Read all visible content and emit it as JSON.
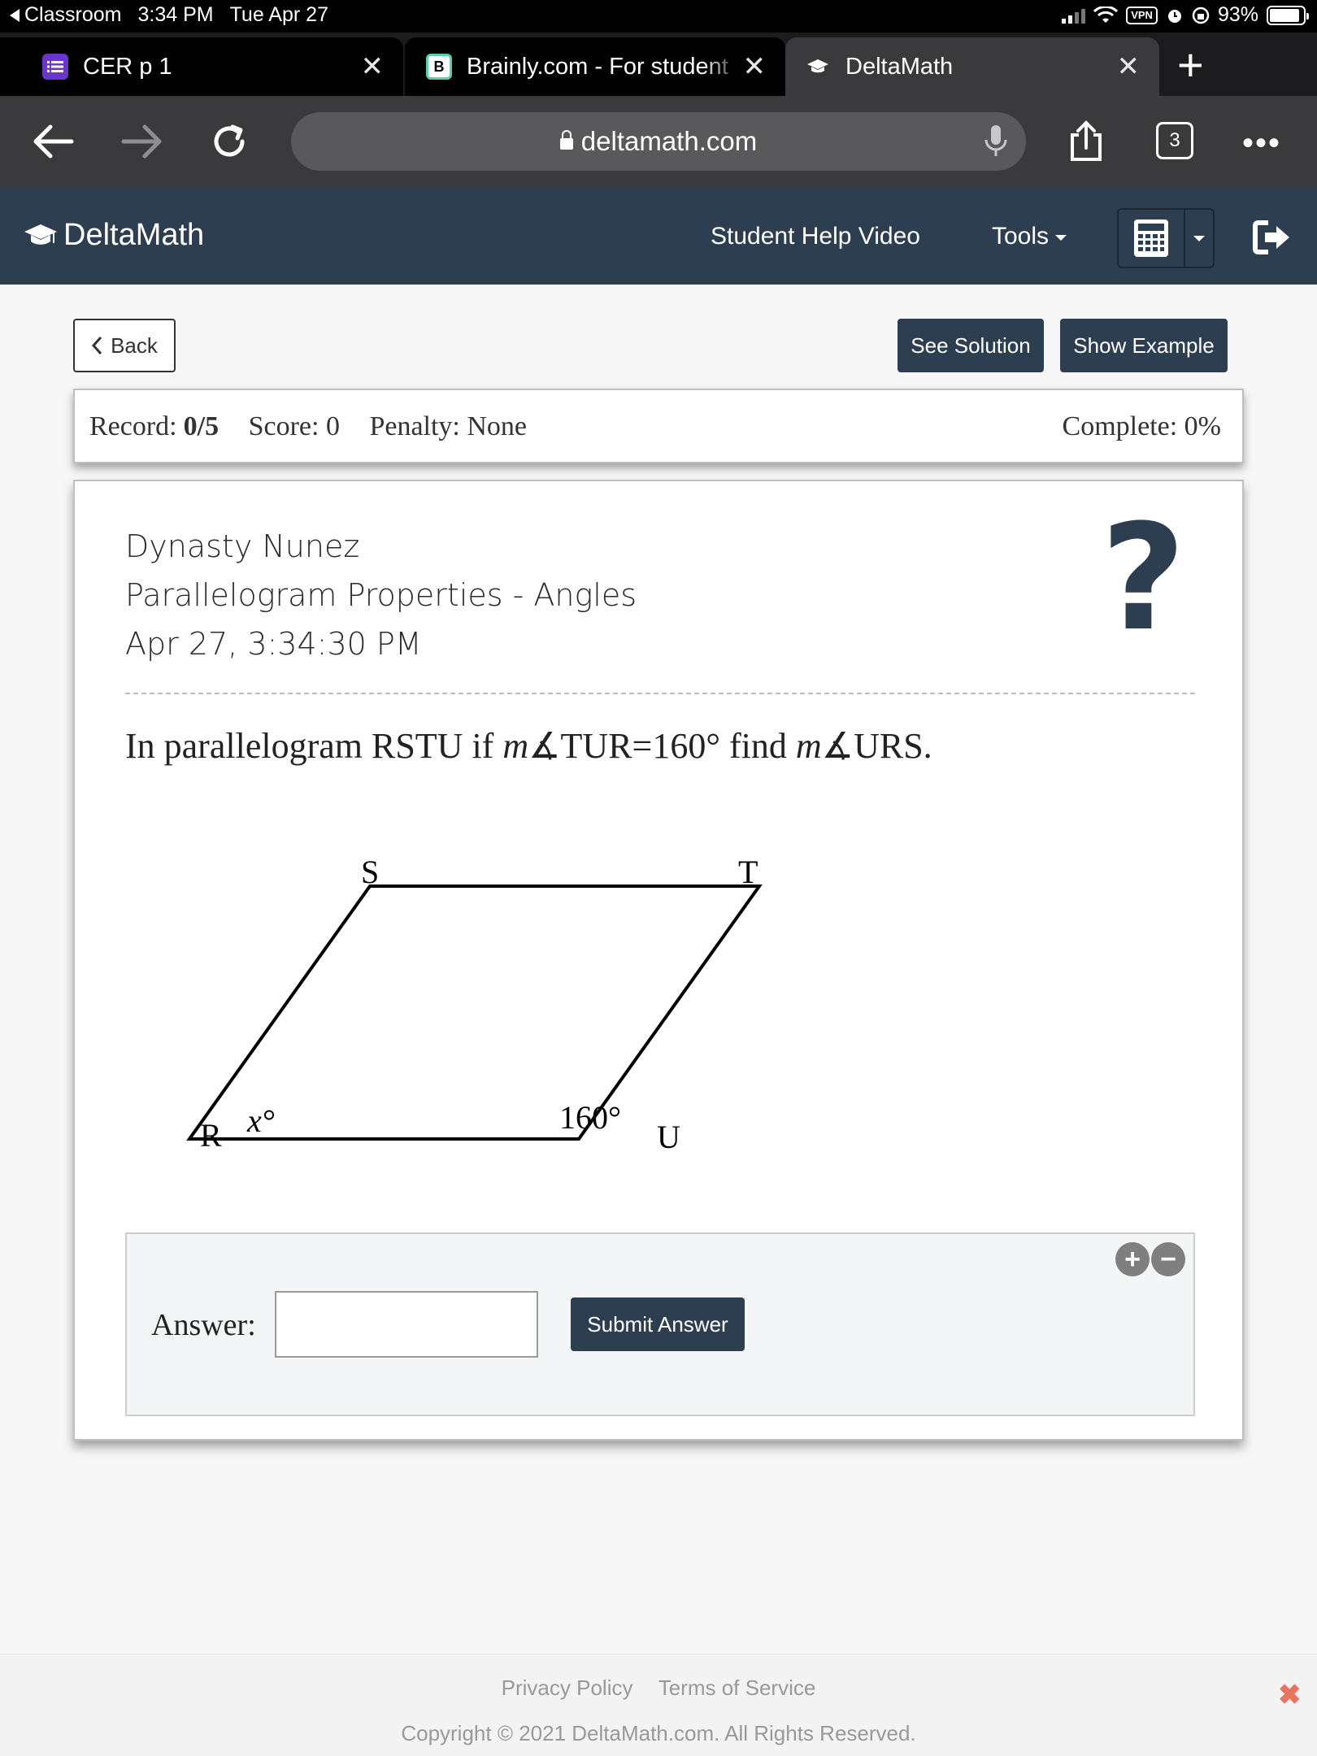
{
  "status_bar": {
    "back_app": "Classroom",
    "time": "3:34 PM",
    "date": "Tue Apr 27",
    "vpn": "VPN",
    "battery": "93%",
    "battery_level": 0.93
  },
  "tabs": [
    {
      "title": "CER p 1",
      "favicon": "list-icon",
      "favicon_color": "#6b35c9",
      "close": "✕"
    },
    {
      "title": "Brainly.com - For student",
      "favicon": "brainly-b-icon",
      "favicon_text": "B",
      "favicon_color": "#000000",
      "close": "✕"
    },
    {
      "title": "DeltaMath",
      "favicon": "graduation-cap-icon",
      "close": "✕"
    }
  ],
  "new_tab_label": "+",
  "browser": {
    "url": "deltamath.com",
    "tab_count": "3",
    "more": "•••"
  },
  "header": {
    "logo": "DeltaMath",
    "help_video": "Student Help Video",
    "tools": "Tools"
  },
  "toolbar": {
    "back": "Back",
    "see_solution": "See Solution",
    "show_example": "Show Example"
  },
  "record": {
    "record_label": "Record:",
    "record_value": "0/5",
    "score": "Score: 0",
    "penalty": "Penalty: None",
    "complete": "Complete: 0%"
  },
  "problem": {
    "student": "Dynasty Nunez",
    "topic": "Parallelogram Properties - Angles",
    "timestamp": "Apr 27, 3:34:30 PM",
    "help_symbol": "?",
    "question_pre": "In parallelogram RSTU if ",
    "question_m1": "m",
    "question_given": "∡TUR=160°",
    "question_mid": " find ",
    "question_m2": "m",
    "question_target": "∡URS."
  },
  "diagram": {
    "labels": {
      "S": "S",
      "T": "T",
      "R": "R",
      "U": "U"
    },
    "angle_R": "x°",
    "angle_U": "160°"
  },
  "answer": {
    "label": "Answer:",
    "value": "",
    "submit": "Submit Answer",
    "zoom_in": "+",
    "zoom_out": "−"
  },
  "footer": {
    "privacy": "Privacy Policy",
    "terms": "Terms of Service",
    "copyright": "Copyright © 2021 DeltaMath.com. All Rights Reserved.",
    "close": "✖"
  }
}
